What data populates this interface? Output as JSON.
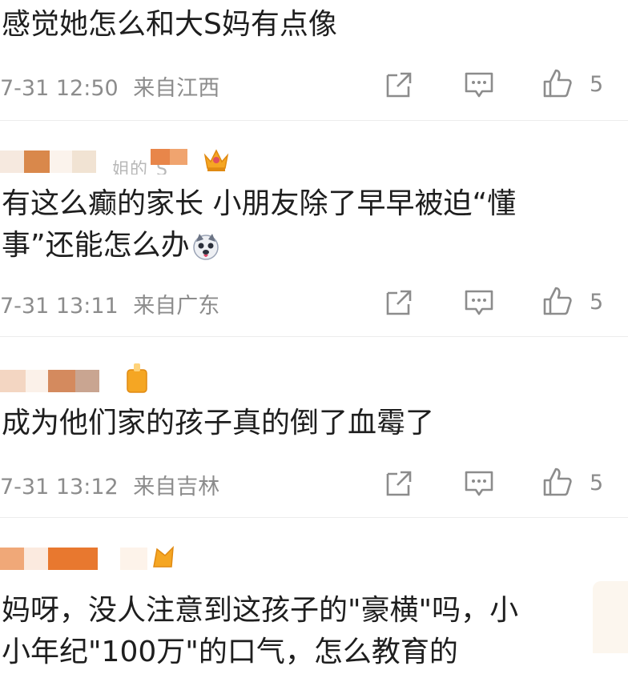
{
  "comments": [
    {
      "text_lines": [
        "感觉她怎么和大S妈有点像"
      ],
      "time": "7-31 12:50",
      "location": "来自江西",
      "likes": "5"
    },
    {
      "username_partial": "姐的_S",
      "text_lines": [
        "有这么癫的家长 小朋友除了早早被迫“懂",
        "事”还能怎么办"
      ],
      "emoji": "husky-emoji",
      "time": "7-31 13:11",
      "location": "来自广东",
      "likes": "5"
    },
    {
      "text_lines": [
        "成为他们家的孩子真的倒了血霉了"
      ],
      "time": "7-31 13:12",
      "location": "来自吉林",
      "likes": "5"
    },
    {
      "text_lines": [
        "妈呀，没人注意到这孩子的\"豪横\"吗，小",
        "小年纪\"100万\"的口气，怎么教育的"
      ]
    }
  ],
  "icons": {
    "share": "share-icon",
    "comment": "comment-icon",
    "like": "thumbs-up-icon",
    "badge": "crown-badge-icon"
  },
  "colors": {
    "meta_text": "#8c8c8c",
    "body_text": "#1e1e1e",
    "divider": "#ececec",
    "badge": "#f5a623"
  }
}
